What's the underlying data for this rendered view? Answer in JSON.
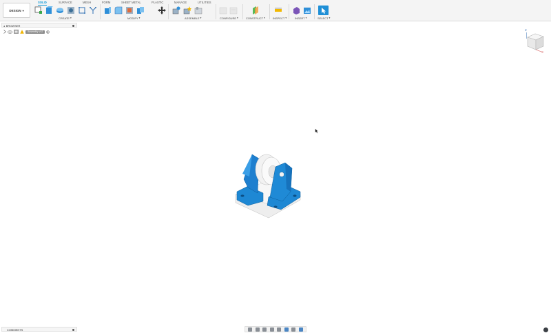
{
  "workspace": {
    "label": "DESIGN",
    "caret": "▾"
  },
  "tabs": [
    "SOLID",
    "SURFACE",
    "MESH",
    "FORM",
    "SHEET METAL",
    "PLASTIC",
    "MANAGE",
    "UTILITIES"
  ],
  "active_tab": "SOLID",
  "groups": {
    "create": "CREATE",
    "modify": "MODIFY",
    "assemble": "ASSEMBLE",
    "configure": "CONFIGURE",
    "construct": "CONSTRUCT",
    "inspect": "INSPECT",
    "insert": "INSERT",
    "select": "SELECT"
  },
  "caret": "▾",
  "browser": {
    "title": "BROWSER",
    "collapse_glyph": "◂"
  },
  "tree": {
    "root_label": "Assembly v12"
  },
  "comments": {
    "title": "COMMENTS"
  },
  "viewcube": {
    "axis_z": "Z",
    "axis_x": "X"
  },
  "colors": {
    "accent": "#0696d7",
    "part_blue": "#1e88d4",
    "part_white": "#f2f2f2"
  },
  "icons": {
    "create": [
      "new-component-icon",
      "extrude-icon",
      "revolve-icon",
      "hole-icon",
      "rectangle-icon",
      "sketch-icon"
    ],
    "modify": [
      "press-pull-icon",
      "fillet-icon",
      "shell-icon",
      "combine-icon",
      "move-icon"
    ],
    "assemble": [
      "new-joint-icon",
      "joint-origin-icon",
      "motion-icon"
    ],
    "construct": [
      "offset-plane-icon"
    ],
    "inspect": [
      "measure-icon"
    ],
    "insert": [
      "insert-mesh-icon",
      "insert-image-icon"
    ],
    "select": [
      "select-arrow-icon"
    ]
  }
}
